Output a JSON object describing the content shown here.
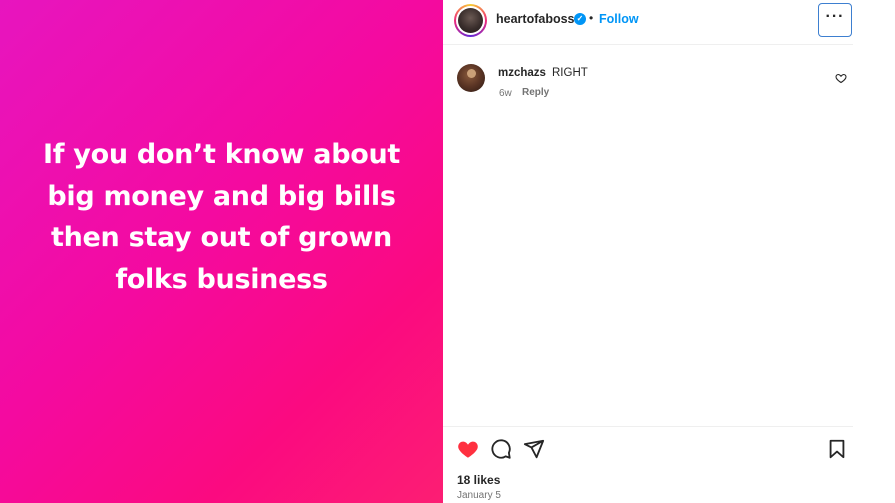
{
  "post": {
    "caption_text": "If you don’t know about\nbig money and big bills\nthen stay out of grown\nfolks business",
    "background_colors": [
      "#e715bf",
      "#fb0a80"
    ]
  },
  "header": {
    "username": "heartofaboss",
    "verified_icon": "verified-badge-icon",
    "separator": "•",
    "follow_label": "Follow",
    "more_label": "···"
  },
  "comment": {
    "username": "mzchazs",
    "text": "RIGHT",
    "time": "6w",
    "reply_label": "Reply",
    "like_icon": "heart-outline-icon"
  },
  "actions": {
    "like_icon": "heart-filled-icon",
    "like_color": "#ff3040",
    "comment_icon": "comment-icon",
    "share_icon": "share-icon",
    "save_icon": "bookmark-icon"
  },
  "footer": {
    "likes": "18 likes",
    "date": "January 5"
  },
  "colors": {
    "accent": "#0095f6",
    "text": "#262626",
    "muted": "#737373"
  }
}
